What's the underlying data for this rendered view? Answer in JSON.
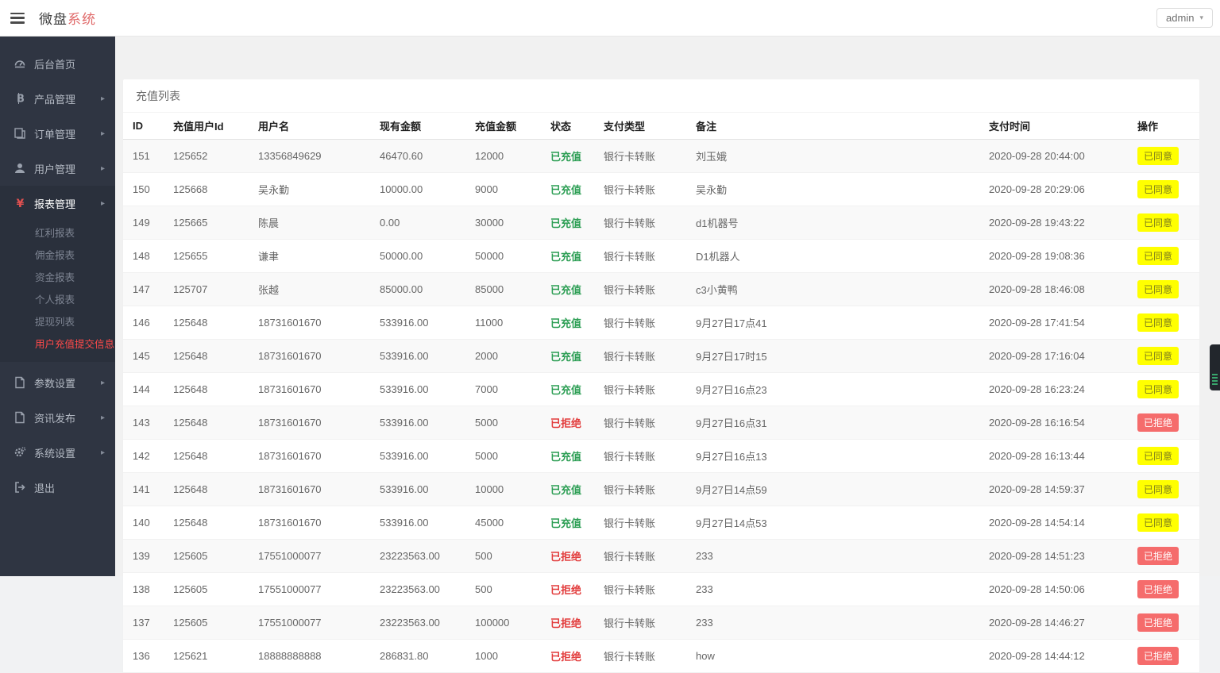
{
  "header": {
    "logo_primary": "微盘",
    "logo_accent": "系统",
    "user_menu_label": "admin"
  },
  "sidebar": {
    "items": [
      {
        "key": "dashboard",
        "label": "后台首页",
        "icon": "dashboard-icon",
        "has_arrow": false
      },
      {
        "key": "products",
        "label": "产品管理",
        "icon": "bitcoin-icon",
        "has_arrow": true
      },
      {
        "key": "orders",
        "label": "订单管理",
        "icon": "orders-icon",
        "has_arrow": true
      },
      {
        "key": "users",
        "label": "用户管理",
        "icon": "user-icon",
        "has_arrow": true
      },
      {
        "key": "reports",
        "label": "报表管理",
        "icon": "yen-icon",
        "has_arrow": true,
        "expanded": true,
        "children": [
          {
            "key": "bonus-report",
            "label": "红利报表",
            "active": false
          },
          {
            "key": "commission-report",
            "label": "佣金报表",
            "active": false
          },
          {
            "key": "funds-report",
            "label": "资金报表",
            "active": false
          },
          {
            "key": "personal-report",
            "label": "个人报表",
            "active": false
          },
          {
            "key": "withdraw-list",
            "label": "提现列表",
            "active": false
          },
          {
            "key": "user-recharge-info",
            "label": "用户充值提交信息",
            "active": true
          }
        ]
      },
      {
        "key": "params",
        "label": "参数设置",
        "icon": "doc-icon",
        "has_arrow": true
      },
      {
        "key": "news",
        "label": "资讯发布",
        "icon": "doc-icon",
        "has_arrow": true
      },
      {
        "key": "settings",
        "label": "系统设置",
        "icon": "gear-icon",
        "has_arrow": true
      },
      {
        "key": "logout",
        "label": "退出",
        "icon": "logout-icon",
        "has_arrow": false
      }
    ]
  },
  "main": {
    "card_title": "充值列表"
  },
  "table": {
    "columns": [
      {
        "key": "id",
        "label": "ID"
      },
      {
        "key": "user_id",
        "label": "充值用户Id"
      },
      {
        "key": "username",
        "label": "用户名"
      },
      {
        "key": "balance",
        "label": "现有金额"
      },
      {
        "key": "amount",
        "label": "充值金额"
      },
      {
        "key": "status",
        "label": "状态"
      },
      {
        "key": "pay_type",
        "label": "支付类型"
      },
      {
        "key": "remark",
        "label": "备注"
      },
      {
        "key": "pay_time",
        "label": "支付时间"
      },
      {
        "key": "action",
        "label": "操作"
      }
    ],
    "rows": [
      {
        "id": "151",
        "user_id": "125652",
        "username": "13356849629",
        "balance": "46470.60",
        "amount": "12000",
        "status": "已充值",
        "status_ok": true,
        "pay_type": "银行卡转账",
        "remark": "刘玉娥",
        "pay_time": "2020-09-28 20:44:00",
        "action": "已同意",
        "action_ok": true
      },
      {
        "id": "150",
        "user_id": "125668",
        "username": "吴永勤",
        "balance": "10000.00",
        "amount": "9000",
        "status": "已充值",
        "status_ok": true,
        "pay_type": "银行卡转账",
        "remark": "吴永勤",
        "pay_time": "2020-09-28 20:29:06",
        "action": "已同意",
        "action_ok": true
      },
      {
        "id": "149",
        "user_id": "125665",
        "username": "陈晨",
        "balance": "0.00",
        "amount": "30000",
        "status": "已充值",
        "status_ok": true,
        "pay_type": "银行卡转账",
        "remark": "d1机器号",
        "pay_time": "2020-09-28 19:43:22",
        "action": "已同意",
        "action_ok": true
      },
      {
        "id": "148",
        "user_id": "125655",
        "username": "谦聿",
        "balance": "50000.00",
        "amount": "50000",
        "status": "已充值",
        "status_ok": true,
        "pay_type": "银行卡转账",
        "remark": "D1机器人",
        "pay_time": "2020-09-28 19:08:36",
        "action": "已同意",
        "action_ok": true
      },
      {
        "id": "147",
        "user_id": "125707",
        "username": "张越",
        "balance": "85000.00",
        "amount": "85000",
        "status": "已充值",
        "status_ok": true,
        "pay_type": "银行卡转账",
        "remark": "c3小黄鸭",
        "pay_time": "2020-09-28 18:46:08",
        "action": "已同意",
        "action_ok": true
      },
      {
        "id": "146",
        "user_id": "125648",
        "username": "18731601670",
        "balance": "533916.00",
        "amount": "11000",
        "status": "已充值",
        "status_ok": true,
        "pay_type": "银行卡转账",
        "remark": "9月27日17点41",
        "pay_time": "2020-09-28 17:41:54",
        "action": "已同意",
        "action_ok": true
      },
      {
        "id": "145",
        "user_id": "125648",
        "username": "18731601670",
        "balance": "533916.00",
        "amount": "2000",
        "status": "已充值",
        "status_ok": true,
        "pay_type": "银行卡转账",
        "remark": "9月27日17时15",
        "pay_time": "2020-09-28 17:16:04",
        "action": "已同意",
        "action_ok": true
      },
      {
        "id": "144",
        "user_id": "125648",
        "username": "18731601670",
        "balance": "533916.00",
        "amount": "7000",
        "status": "已充值",
        "status_ok": true,
        "pay_type": "银行卡转账",
        "remark": "9月27日16点23",
        "pay_time": "2020-09-28 16:23:24",
        "action": "已同意",
        "action_ok": true
      },
      {
        "id": "143",
        "user_id": "125648",
        "username": "18731601670",
        "balance": "533916.00",
        "amount": "5000",
        "status": "已拒绝",
        "status_ok": false,
        "pay_type": "银行卡转账",
        "remark": "9月27日16点31",
        "pay_time": "2020-09-28 16:16:54",
        "action": "已拒绝",
        "action_ok": false
      },
      {
        "id": "142",
        "user_id": "125648",
        "username": "18731601670",
        "balance": "533916.00",
        "amount": "5000",
        "status": "已充值",
        "status_ok": true,
        "pay_type": "银行卡转账",
        "remark": "9月27日16点13",
        "pay_time": "2020-09-28 16:13:44",
        "action": "已同意",
        "action_ok": true
      },
      {
        "id": "141",
        "user_id": "125648",
        "username": "18731601670",
        "balance": "533916.00",
        "amount": "10000",
        "status": "已充值",
        "status_ok": true,
        "pay_type": "银行卡转账",
        "remark": "9月27日14点59",
        "pay_time": "2020-09-28 14:59:37",
        "action": "已同意",
        "action_ok": true
      },
      {
        "id": "140",
        "user_id": "125648",
        "username": "18731601670",
        "balance": "533916.00",
        "amount": "45000",
        "status": "已充值",
        "status_ok": true,
        "pay_type": "银行卡转账",
        "remark": "9月27日14点53",
        "pay_time": "2020-09-28 14:54:14",
        "action": "已同意",
        "action_ok": true
      },
      {
        "id": "139",
        "user_id": "125605",
        "username": "17551000077",
        "balance": "23223563.00",
        "amount": "500",
        "status": "已拒绝",
        "status_ok": false,
        "pay_type": "银行卡转账",
        "remark": "233",
        "pay_time": "2020-09-28 14:51:23",
        "action": "已拒绝",
        "action_ok": false
      },
      {
        "id": "138",
        "user_id": "125605",
        "username": "17551000077",
        "balance": "23223563.00",
        "amount": "500",
        "status": "已拒绝",
        "status_ok": false,
        "pay_type": "银行卡转账",
        "remark": "233",
        "pay_time": "2020-09-28 14:50:06",
        "action": "已拒绝",
        "action_ok": false
      },
      {
        "id": "137",
        "user_id": "125605",
        "username": "17551000077",
        "balance": "23223563.00",
        "amount": "100000",
        "status": "已拒绝",
        "status_ok": false,
        "pay_type": "银行卡转账",
        "remark": "233",
        "pay_time": "2020-09-28 14:46:27",
        "action": "已拒绝",
        "action_ok": false
      },
      {
        "id": "136",
        "user_id": "125621",
        "username": "18888888888",
        "balance": "286831.80",
        "amount": "1000",
        "status": "已拒绝",
        "status_ok": false,
        "pay_type": "银行卡转账",
        "remark": "how",
        "pay_time": "2020-09-28 14:44:12",
        "action": "已拒绝",
        "action_ok": false
      }
    ]
  },
  "colors": {
    "logo_accent": "#e06a6a",
    "sidebar_bg": "#2f3542",
    "sidebar_active_text": "#ff4a4a",
    "status_ok": "#2c9e54",
    "status_rejected": "#e23c3c",
    "btn_approved_bg": "#ffff00",
    "btn_rejected_bg": "#f56c6c"
  }
}
